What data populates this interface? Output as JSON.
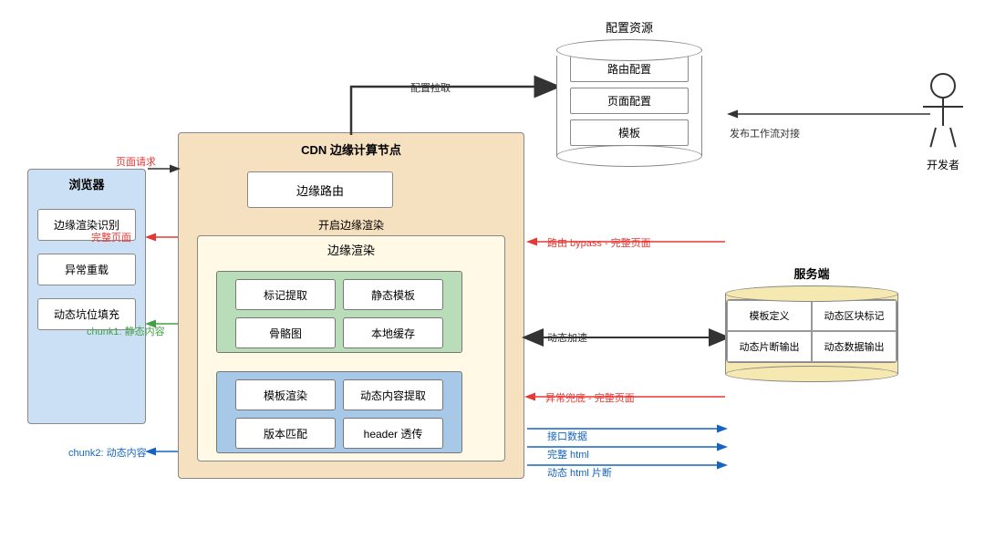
{
  "browser": {
    "title": "浏览器",
    "items": [
      "边缘渲染识别",
      "异常重载",
      "动态坑位填充"
    ]
  },
  "cdn": {
    "title": "CDN 边缘计算节点",
    "edge_routing": "边缘路由",
    "edge_render_label": "开启边缘渲染",
    "edge_render_title": "边缘渲染",
    "static_items": [
      "标记提取",
      "静态模板",
      "骨骼图",
      "本地缓存"
    ],
    "dynamic_items": [
      "模板渲染",
      "动态内容提取",
      "版本匹配",
      "header 透传"
    ]
  },
  "config": {
    "title": "配置资源",
    "items": [
      "路由配置",
      "页面配置",
      "模板"
    ]
  },
  "server": {
    "title": "服务端",
    "cells": [
      "模板定义",
      "动态区块标记",
      "动态片断输出",
      "动态数据输出"
    ]
  },
  "developer": {
    "label": "开发者"
  },
  "arrows": {
    "page_request": "页面请求",
    "full_page": "完整页面",
    "chunk1": "chunk1: 静态内容",
    "chunk2": "chunk2: 动态内容",
    "config_fetch": "配置拉取",
    "publish_flow": "发布工作流对接",
    "route_bypass": "路由 bypass - 完整页面",
    "dynamic_accel": "动态加速",
    "error_fallback": "异常兜底 - 完整页面",
    "interface_data": "接口数据",
    "full_html": "完整 html",
    "dynamic_html": "动态 html 片断"
  }
}
